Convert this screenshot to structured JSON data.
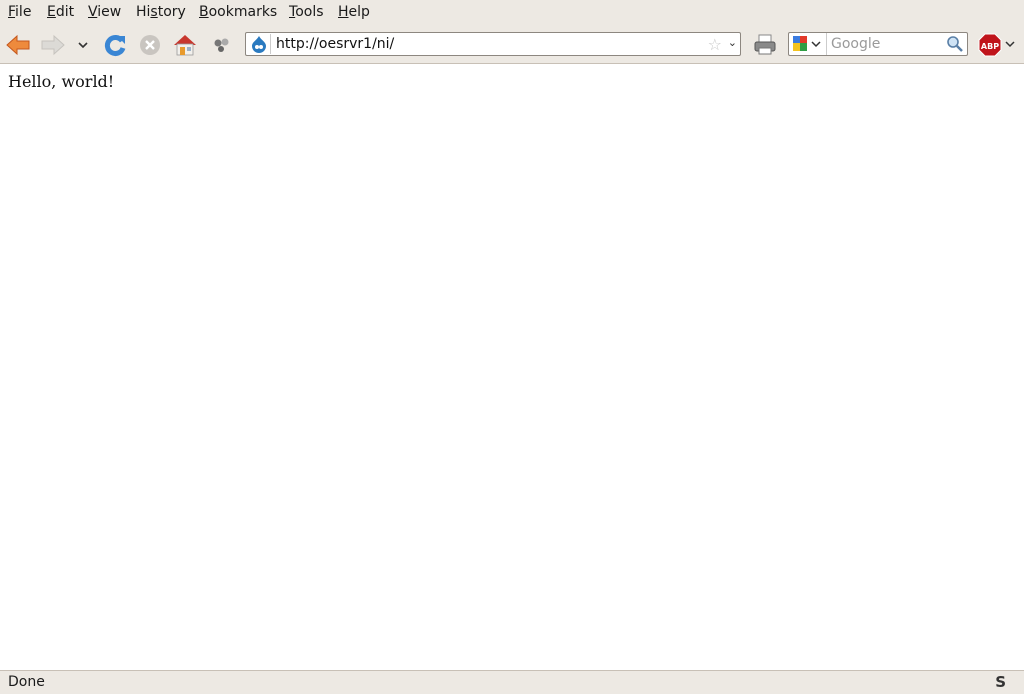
{
  "menubar": {
    "items": [
      {
        "label": "File",
        "accel": "F",
        "rest": "ile"
      },
      {
        "label": "Edit",
        "accel": "E",
        "rest": "dit"
      },
      {
        "label": "View",
        "accel": "V",
        "rest": "iew"
      },
      {
        "label": "History",
        "pre": "Hi",
        "accel": "s",
        "rest": "tory"
      },
      {
        "label": "Bookmarks",
        "accel": "B",
        "rest": "ookmarks"
      },
      {
        "label": "Tools",
        "accel": "T",
        "rest": "ools"
      },
      {
        "label": "Help",
        "accel": "H",
        "rest": "elp"
      }
    ]
  },
  "toolbar": {
    "icons": [
      "back-icon",
      "forward-icon",
      "history-dropdown-icon",
      "reload-icon",
      "stop-icon",
      "home-icon",
      "extension-icon",
      "print-icon",
      "adblock-icon"
    ],
    "url": "http://oesrvr1/ni/",
    "search_placeholder": "Google",
    "adblock_label": "ABP"
  },
  "content": {
    "text": "Hello, world!"
  },
  "statusbar": {
    "text": "Done",
    "icon_label": "S"
  },
  "colors": {
    "chrome_bg": "#ede9e3",
    "back_arrow": "#e8732a",
    "reload": "#3a86d4",
    "home_roof": "#c8372d",
    "abp": "#c0141b"
  }
}
